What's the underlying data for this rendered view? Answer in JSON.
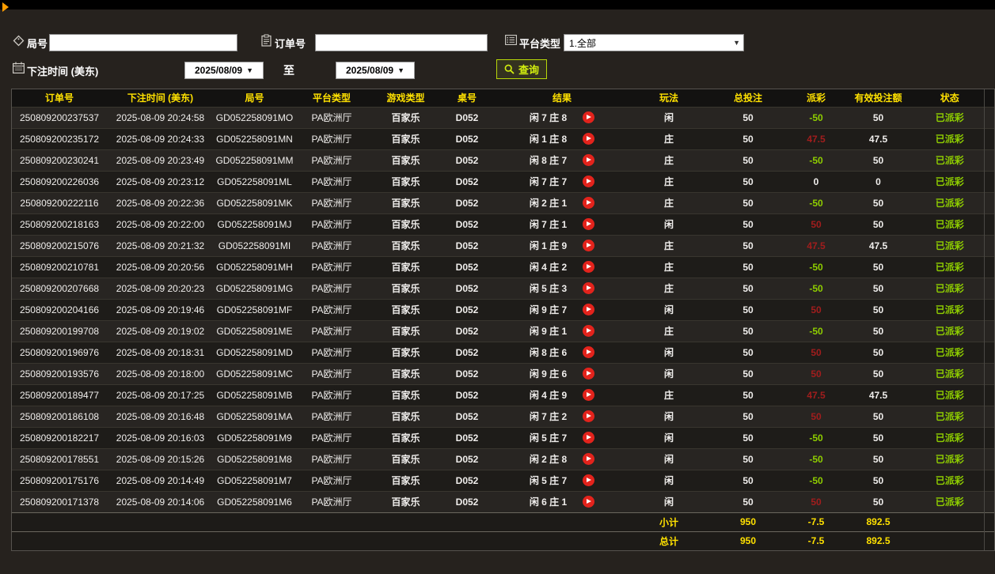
{
  "filters": {
    "round": {
      "label": "局号",
      "value": ""
    },
    "order": {
      "label": "订单号",
      "value": ""
    },
    "platform": {
      "label": "平台类型",
      "value": "1.全部"
    },
    "bet_time": {
      "label": "下注时间 (美东)",
      "from": "2025/08/09",
      "to_label": "至",
      "to": "2025/08/09"
    },
    "query_label": "查询"
  },
  "table": {
    "headers": [
      "订单号",
      "下注时间 (美东)",
      "局号",
      "平台类型",
      "游戏类型",
      "桌号",
      "结果",
      "玩法",
      "总投注",
      "派彩",
      "有效投注额",
      "状态"
    ],
    "rows": [
      {
        "order_id": "250809200237537",
        "time": "2025-08-09 20:24:58",
        "round": "GD052258091MO",
        "platform": "PA欧洲厅",
        "game": "百家乐",
        "table_no": "D052",
        "result": "闲 7 庄 8",
        "play": "闲",
        "total_bet": "50",
        "payout": "-50",
        "payout_class": "neg",
        "valid_bet": "50",
        "status": "已派彩"
      },
      {
        "order_id": "250809200235172",
        "time": "2025-08-09 20:24:33",
        "round": "GD052258091MN",
        "platform": "PA欧洲厅",
        "game": "百家乐",
        "table_no": "D052",
        "result": "闲 1 庄 8",
        "play": "庄",
        "total_bet": "50",
        "payout": "47.5",
        "payout_class": "pos",
        "valid_bet": "47.5",
        "status": "已派彩"
      },
      {
        "order_id": "250809200230241",
        "time": "2025-08-09 20:23:49",
        "round": "GD052258091MM",
        "platform": "PA欧洲厅",
        "game": "百家乐",
        "table_no": "D052",
        "result": "闲 8 庄 7",
        "play": "庄",
        "total_bet": "50",
        "payout": "-50",
        "payout_class": "neg",
        "valid_bet": "50",
        "status": "已派彩"
      },
      {
        "order_id": "250809200226036",
        "time": "2025-08-09 20:23:12",
        "round": "GD052258091ML",
        "platform": "PA欧洲厅",
        "game": "百家乐",
        "table_no": "D052",
        "result": "闲 7 庄 7",
        "play": "庄",
        "total_bet": "50",
        "payout": "0",
        "payout_class": "zero",
        "valid_bet": "0",
        "status": "已派彩"
      },
      {
        "order_id": "250809200222116",
        "time": "2025-08-09 20:22:36",
        "round": "GD052258091MK",
        "platform": "PA欧洲厅",
        "game": "百家乐",
        "table_no": "D052",
        "result": "闲 2 庄 1",
        "play": "庄",
        "total_bet": "50",
        "payout": "-50",
        "payout_class": "neg",
        "valid_bet": "50",
        "status": "已派彩"
      },
      {
        "order_id": "250809200218163",
        "time": "2025-08-09 20:22:00",
        "round": "GD052258091MJ",
        "platform": "PA欧洲厅",
        "game": "百家乐",
        "table_no": "D052",
        "result": "闲 7 庄 1",
        "play": "闲",
        "total_bet": "50",
        "payout": "50",
        "payout_class": "pos",
        "valid_bet": "50",
        "status": "已派彩"
      },
      {
        "order_id": "250809200215076",
        "time": "2025-08-09 20:21:32",
        "round": "GD052258091MI",
        "platform": "PA欧洲厅",
        "game": "百家乐",
        "table_no": "D052",
        "result": "闲 1 庄 9",
        "play": "庄",
        "total_bet": "50",
        "payout": "47.5",
        "payout_class": "pos",
        "valid_bet": "47.5",
        "status": "已派彩"
      },
      {
        "order_id": "250809200210781",
        "time": "2025-08-09 20:20:56",
        "round": "GD052258091MH",
        "platform": "PA欧洲厅",
        "game": "百家乐",
        "table_no": "D052",
        "result": "闲 4 庄 2",
        "play": "庄",
        "total_bet": "50",
        "payout": "-50",
        "payout_class": "neg",
        "valid_bet": "50",
        "status": "已派彩"
      },
      {
        "order_id": "250809200207668",
        "time": "2025-08-09 20:20:23",
        "round": "GD052258091MG",
        "platform": "PA欧洲厅",
        "game": "百家乐",
        "table_no": "D052",
        "result": "闲 5 庄 3",
        "play": "庄",
        "total_bet": "50",
        "payout": "-50",
        "payout_class": "neg",
        "valid_bet": "50",
        "status": "已派彩"
      },
      {
        "order_id": "250809200204166",
        "time": "2025-08-09 20:19:46",
        "round": "GD052258091MF",
        "platform": "PA欧洲厅",
        "game": "百家乐",
        "table_no": "D052",
        "result": "闲 9 庄 7",
        "play": "闲",
        "total_bet": "50",
        "payout": "50",
        "payout_class": "pos",
        "valid_bet": "50",
        "status": "已派彩"
      },
      {
        "order_id": "250809200199708",
        "time": "2025-08-09 20:19:02",
        "round": "GD052258091ME",
        "platform": "PA欧洲厅",
        "game": "百家乐",
        "table_no": "D052",
        "result": "闲 9 庄 1",
        "play": "庄",
        "total_bet": "50",
        "payout": "-50",
        "payout_class": "neg",
        "valid_bet": "50",
        "status": "已派彩"
      },
      {
        "order_id": "250809200196976",
        "time": "2025-08-09 20:18:31",
        "round": "GD052258091MD",
        "platform": "PA欧洲厅",
        "game": "百家乐",
        "table_no": "D052",
        "result": "闲 8 庄 6",
        "play": "闲",
        "total_bet": "50",
        "payout": "50",
        "payout_class": "pos",
        "valid_bet": "50",
        "status": "已派彩"
      },
      {
        "order_id": "250809200193576",
        "time": "2025-08-09 20:18:00",
        "round": "GD052258091MC",
        "platform": "PA欧洲厅",
        "game": "百家乐",
        "table_no": "D052",
        "result": "闲 9 庄 6",
        "play": "闲",
        "total_bet": "50",
        "payout": "50",
        "payout_class": "pos",
        "valid_bet": "50",
        "status": "已派彩"
      },
      {
        "order_id": "250809200189477",
        "time": "2025-08-09 20:17:25",
        "round": "GD052258091MB",
        "platform": "PA欧洲厅",
        "game": "百家乐",
        "table_no": "D052",
        "result": "闲 4 庄 9",
        "play": "庄",
        "total_bet": "50",
        "payout": "47.5",
        "payout_class": "pos",
        "valid_bet": "47.5",
        "status": "已派彩"
      },
      {
        "order_id": "250809200186108",
        "time": "2025-08-09 20:16:48",
        "round": "GD052258091MA",
        "platform": "PA欧洲厅",
        "game": "百家乐",
        "table_no": "D052",
        "result": "闲 7 庄 2",
        "play": "闲",
        "total_bet": "50",
        "payout": "50",
        "payout_class": "pos",
        "valid_bet": "50",
        "status": "已派彩"
      },
      {
        "order_id": "250809200182217",
        "time": "2025-08-09 20:16:03",
        "round": "GD052258091M9",
        "platform": "PA欧洲厅",
        "game": "百家乐",
        "table_no": "D052",
        "result": "闲 5 庄 7",
        "play": "闲",
        "total_bet": "50",
        "payout": "-50",
        "payout_class": "neg",
        "valid_bet": "50",
        "status": "已派彩"
      },
      {
        "order_id": "250809200178551",
        "time": "2025-08-09 20:15:26",
        "round": "GD052258091M8",
        "platform": "PA欧洲厅",
        "game": "百家乐",
        "table_no": "D052",
        "result": "闲 2 庄 8",
        "play": "闲",
        "total_bet": "50",
        "payout": "-50",
        "payout_class": "neg",
        "valid_bet": "50",
        "status": "已派彩"
      },
      {
        "order_id": "250809200175176",
        "time": "2025-08-09 20:14:49",
        "round": "GD052258091M7",
        "platform": "PA欧洲厅",
        "game": "百家乐",
        "table_no": "D052",
        "result": "闲 5 庄 7",
        "play": "闲",
        "total_bet": "50",
        "payout": "-50",
        "payout_class": "neg",
        "valid_bet": "50",
        "status": "已派彩"
      },
      {
        "order_id": "250809200171378",
        "time": "2025-08-09 20:14:06",
        "round": "GD052258091M6",
        "platform": "PA欧洲厅",
        "game": "百家乐",
        "table_no": "D052",
        "result": "闲 6 庄 1",
        "play": "闲",
        "total_bet": "50",
        "payout": "50",
        "payout_class": "pos",
        "valid_bet": "50",
        "status": "已派彩"
      }
    ],
    "subtotal": {
      "label": "小计",
      "total_bet": "950",
      "payout": "-7.5",
      "valid_bet": "892.5"
    },
    "total": {
      "label": "总计",
      "total_bet": "950",
      "payout": "-7.5",
      "valid_bet": "892.5"
    }
  },
  "colors": {
    "header_text": "#ffe100",
    "win_red": "#a11d1d",
    "loss_green": "#8fce00",
    "totals_yellow": "#ffe100",
    "accent_orange": "#ff9d00",
    "query_green": "#d3ef0e"
  },
  "icons": {
    "round": "tag-icon",
    "order": "clipboard-icon",
    "platform": "list-icon",
    "bet_time": "calendar-icon",
    "query": "search-icon",
    "result": "play-icon",
    "dropdowns": "chevron-down-icon"
  }
}
